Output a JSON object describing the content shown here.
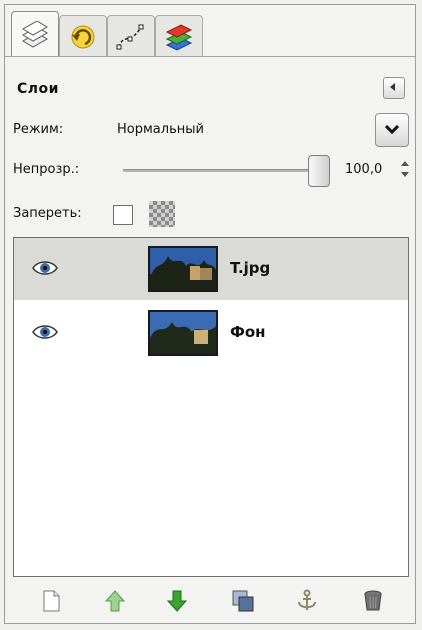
{
  "panel": {
    "title": "Слои",
    "tabs": [
      {
        "name": "layers-tab-icon",
        "active": true
      },
      {
        "name": "undo-history-tab-icon",
        "active": false
      },
      {
        "name": "paths-tab-icon",
        "active": false
      },
      {
        "name": "channels-tab-icon",
        "active": false
      }
    ]
  },
  "mode": {
    "label": "Режим:",
    "value": "Нормальный"
  },
  "opacity": {
    "label": "Непрозр.:",
    "value": "100,0",
    "level": 100
  },
  "lock": {
    "label": "Запереть:"
  },
  "layers": [
    {
      "name": "T.jpg",
      "selected": true
    },
    {
      "name": "Фон",
      "selected": false
    }
  ],
  "toolbar": {
    "icons": [
      "new-layer-icon",
      "raise-layer-icon",
      "lower-layer-icon",
      "duplicate-layer-icon",
      "anchor-layer-icon",
      "delete-layer-icon"
    ]
  },
  "colors": {
    "selected_row": "#dadad7",
    "arrow_green": "#3aa52a"
  }
}
